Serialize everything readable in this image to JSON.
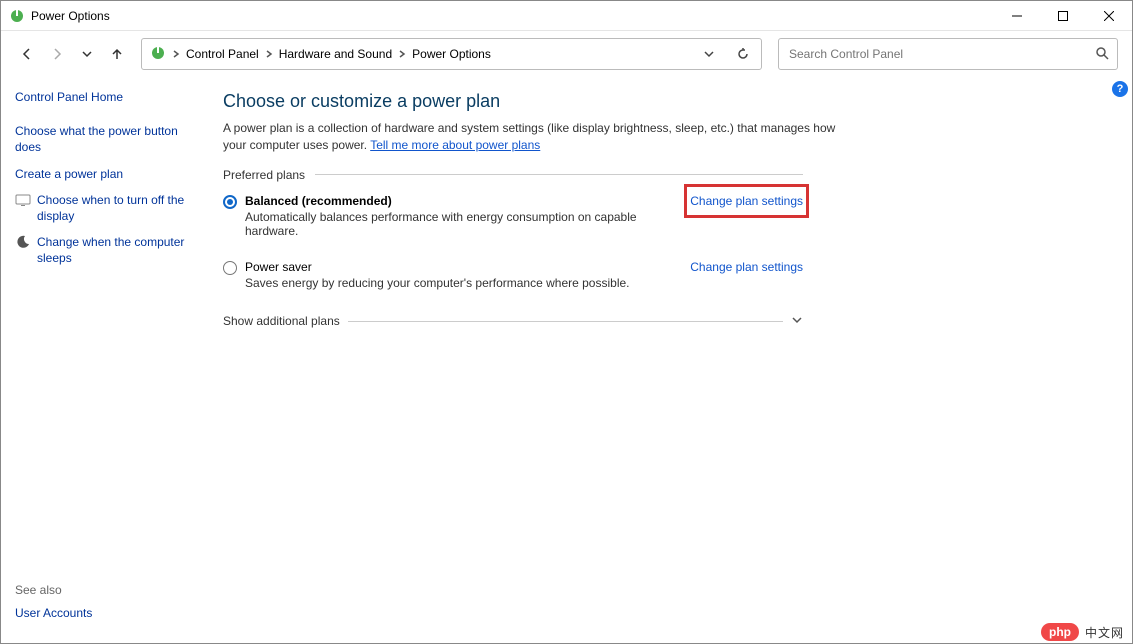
{
  "window": {
    "title": "Power Options"
  },
  "breadcrumbs": {
    "item0": "Control Panel",
    "item1": "Hardware and Sound",
    "item2": "Power Options"
  },
  "search": {
    "placeholder": "Search Control Panel"
  },
  "sidebar": {
    "home": "Control Panel Home",
    "link_power_button": "Choose what the power button does",
    "link_create_plan": "Create a power plan",
    "link_display_off": "Choose when to turn off the display",
    "link_sleep": "Change when the computer sleeps",
    "see_also_label": "See also",
    "see_also_link": "User Accounts"
  },
  "main": {
    "title": "Choose or customize a power plan",
    "desc_before": "A power plan is a collection of hardware and system settings (like display brightness, sleep, etc.) that manages how your computer uses power. ",
    "desc_link": "Tell me more about power plans",
    "preferred_label": "Preferred plans",
    "change_link": "Change plan settings",
    "show_additional": "Show additional plans",
    "plans": [
      {
        "name": "Balanced (recommended)",
        "sub": "Automatically balances performance with energy consumption on capable hardware.",
        "checked": true,
        "highlight_change": true
      },
      {
        "name": "Power saver",
        "sub": "Saves energy by reducing your computer's performance where possible.",
        "checked": false,
        "highlight_change": false
      }
    ]
  },
  "watermark": {
    "pill": "php",
    "text": "中文网"
  }
}
